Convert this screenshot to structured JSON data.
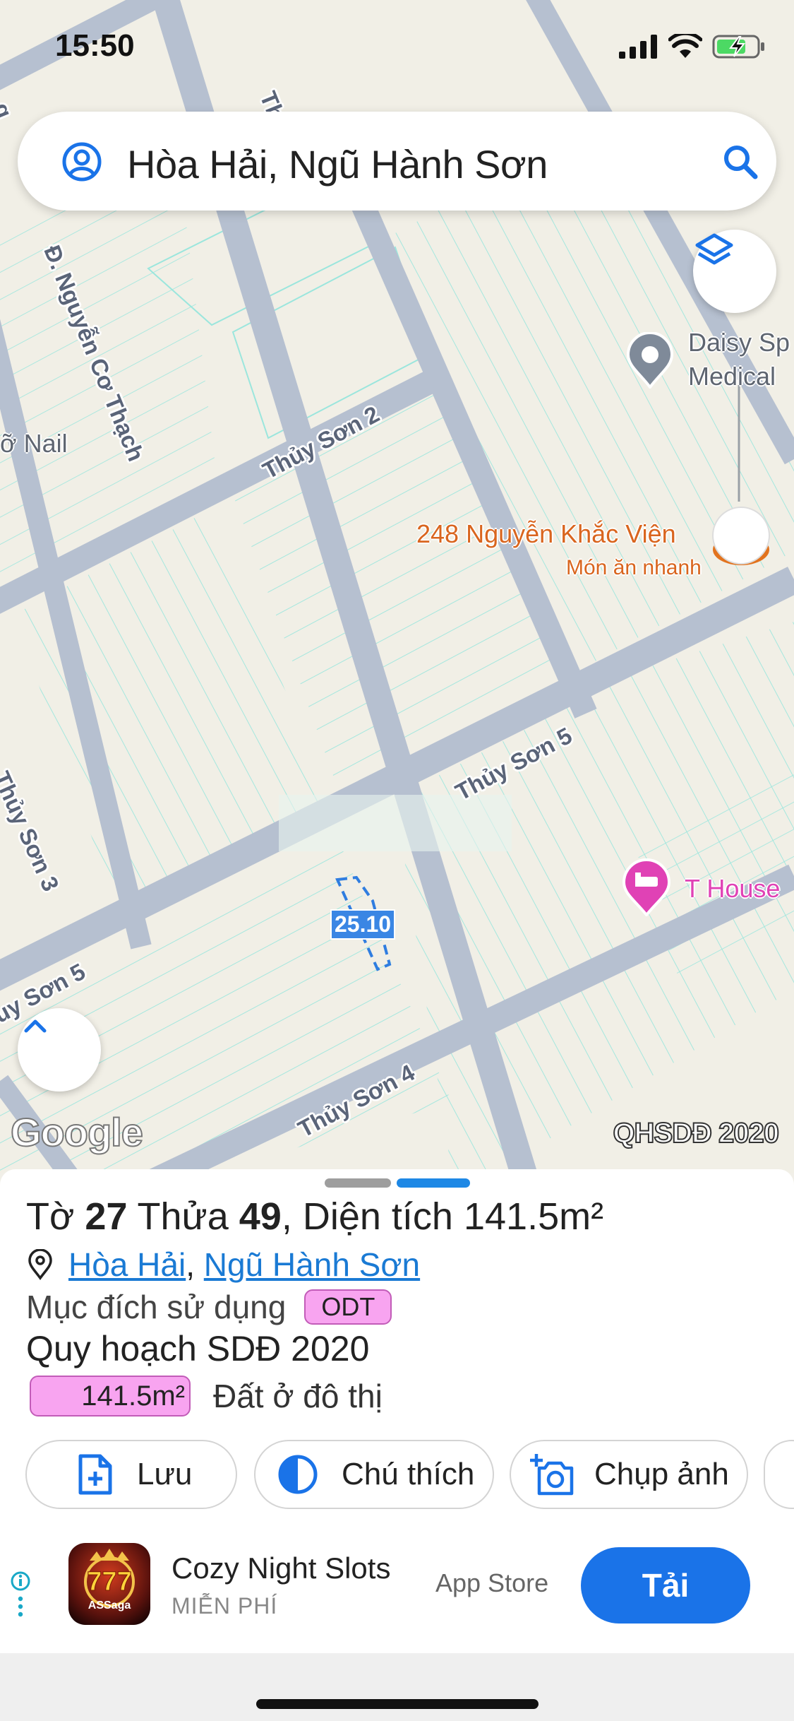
{
  "status": {
    "time": "15:50"
  },
  "search": {
    "query": "Hòa Hải, Ngũ Hành Sơn"
  },
  "map": {
    "streets": {
      "nguyen_co_thach": "Đ. Nguyễn Cơ Thạch",
      "thuy_son_2": "Thủy Sơn 2",
      "thuy_son_3": "Thủy Sơn 3",
      "thuy_son_5_right": "Thủy Sơn 5",
      "thuy_son_5_left": "uy Sơn 5",
      "thuy_son_4": "Thủy Sơn 4",
      "top_street": "Thi",
      "top_left": "g"
    },
    "pois": {
      "daisy_line1": "Daisy Sp",
      "daisy_line2": "Medical",
      "nail": "ỡ Nail",
      "restaurant_name": "248 Nguyễn Khắc Viện",
      "restaurant_type": "Món ăn nhanh",
      "hotel": "T House"
    },
    "parcel_label": "25.10",
    "logo": "Google",
    "layer_badge": "QHSDĐ 2020"
  },
  "parcel": {
    "prefix_to": "Tờ",
    "sheet_no": "27",
    "prefix_thua": "Thửa",
    "parcel_no": "49",
    "area_label": "Diện tích",
    "area_value": "141.5m²",
    "ward": "Hòa Hải",
    "district": "Ngũ Hành Sơn",
    "purpose_label": "Mục đích sử dụng",
    "purpose_code": "ODT",
    "plan_title": "Quy hoạch SDĐ 2020",
    "plan_area": "141.5m²",
    "plan_land_type": "Đất ở đô thị"
  },
  "actions": {
    "save": "Lưu",
    "legend": "Chú thích",
    "photo": "Chụp ảnh"
  },
  "ad": {
    "app_name": "Cozy Night Slots",
    "price": "MIỄN PHÍ",
    "store": "App Store",
    "cta": "Tải",
    "icon_text": "777",
    "icon_sub": "ASSaga"
  },
  "colors": {
    "accent": "#1a73e8",
    "link": "#1a7ad4",
    "road": "#b5bfcf",
    "parcel_line": "#8fe3d9",
    "land_badge": "#f8a4f0",
    "restaurant": "#d9651e",
    "hotel": "#e042b5"
  }
}
